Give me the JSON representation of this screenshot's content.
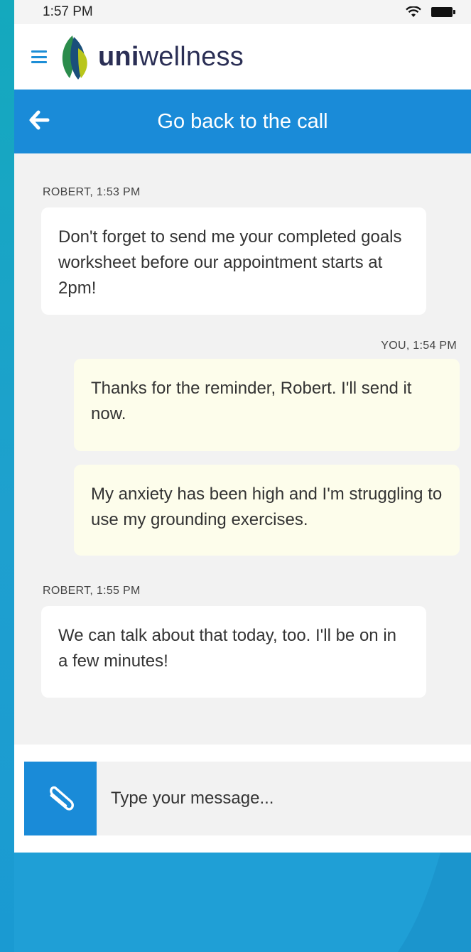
{
  "status_bar": {
    "time": "1:57 PM",
    "icons": [
      "wifi-icon",
      "battery-icon"
    ]
  },
  "header": {
    "logo_bold": "uni",
    "logo_regular": "wellness",
    "menu_icon": "hamburger-menu-icon",
    "logo_icon": "leaf-logo-icon"
  },
  "back_bar": {
    "label": "Go back to the call",
    "icon": "back-arrow-icon"
  },
  "messages": [
    {
      "sender": "ROBERT, 1:53 PM",
      "text": "Don't forget to send me your completed goals worksheet before our appointment starts at 2pm!",
      "direction": "in"
    },
    {
      "sender": "YOU, 1:54 PM",
      "text": "Thanks for the reminder, Robert. I'll send it now.",
      "direction": "out"
    },
    {
      "sender": "",
      "text": "My anxiety has been high and I'm struggling to use my grounding exercises.",
      "direction": "out"
    },
    {
      "sender": "ROBERT, 1:55 PM",
      "text": "We can talk about that today, too. I'll be on in a few minutes!",
      "direction": "in"
    }
  ],
  "composer": {
    "placeholder": "Type your message...",
    "attach_icon": "paperclip-icon"
  },
  "colors": {
    "brand_blue": "#1a8bd8",
    "brand_navy": "#2b2f55",
    "teal_background": "#14a9bd",
    "outgoing_bubble": "#fdfdeb",
    "incoming_bubble": "#ffffff"
  }
}
